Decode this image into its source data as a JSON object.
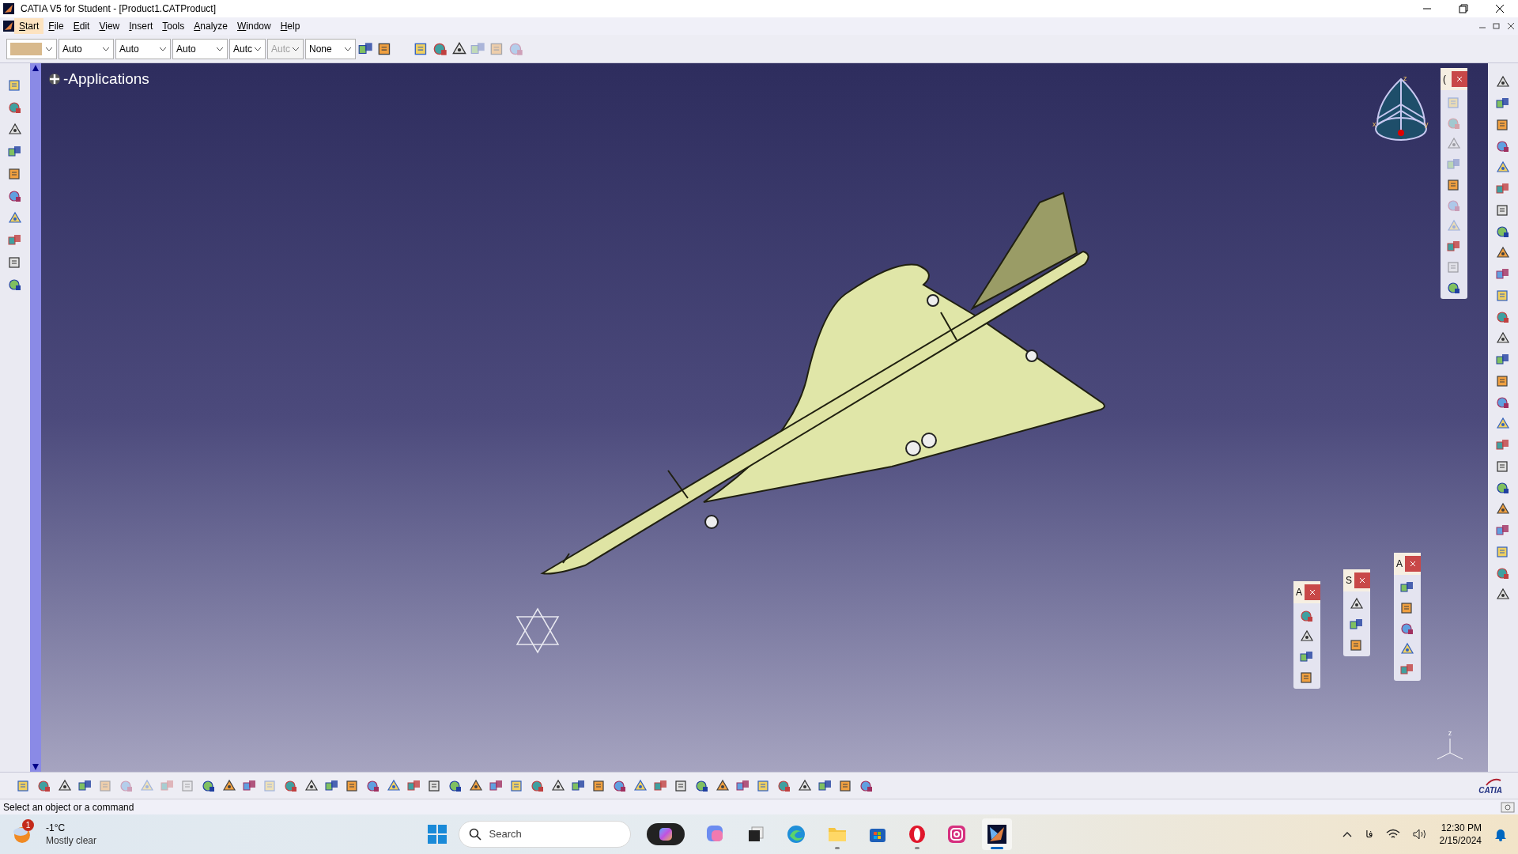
{
  "window": {
    "title": "CATIA V5 for Student - [Product1.CATProduct]"
  },
  "menu": [
    {
      "label": "Start",
      "selected": true
    },
    {
      "label": "File",
      "selected": false
    },
    {
      "label": "Edit",
      "selected": false
    },
    {
      "label": "View",
      "selected": false
    },
    {
      "label": "Insert",
      "selected": false
    },
    {
      "label": "Tools",
      "selected": false
    },
    {
      "label": "Analyze",
      "selected": false
    },
    {
      "label": "Window",
      "selected": false
    },
    {
      "label": "Help",
      "selected": false
    }
  ],
  "combos": [
    {
      "kind": "color",
      "color": "#d8b98c"
    },
    {
      "kind": "text",
      "value": "Auto",
      "disabled": false
    },
    {
      "kind": "text",
      "value": "Auto",
      "disabled": false
    },
    {
      "kind": "text",
      "value": "Auto",
      "disabled": false
    },
    {
      "kind": "text",
      "value": "Autc",
      "disabled": false
    },
    {
      "kind": "text",
      "value": "Autc",
      "disabled": true
    },
    {
      "kind": "text",
      "value": "None",
      "disabled": false
    }
  ],
  "tree": {
    "root": "-Applications"
  },
  "compass": {
    "axes": [
      "z",
      "x",
      "y"
    ]
  },
  "floating_toolbars": [
    {
      "title": "("
    },
    {
      "title": "A"
    },
    {
      "title": "S"
    },
    {
      "title": "A"
    }
  ],
  "axis_triad": {
    "label": "z"
  },
  "logo": {
    "text": "CATIA"
  },
  "status_bar": {
    "text": "Select an object or a command"
  },
  "taskbar": {
    "weather": {
      "badge": "1",
      "temperature": "-1°C",
      "condition": "Mostly clear"
    },
    "search": {
      "placeholder": "Search"
    },
    "apps": [
      {
        "kind": "copilot",
        "running": false,
        "selected": false
      },
      {
        "kind": "preview",
        "running": false,
        "selected": false
      },
      {
        "kind": "taskview",
        "running": false,
        "selected": false
      },
      {
        "kind": "edge",
        "running": false,
        "selected": false
      },
      {
        "kind": "explorer",
        "running": true,
        "selected": false
      },
      {
        "kind": "store",
        "running": false,
        "selected": false
      },
      {
        "kind": "opera",
        "running": true,
        "selected": false
      },
      {
        "kind": "instagram",
        "running": false,
        "selected": false
      },
      {
        "kind": "catia",
        "running": true,
        "selected": true
      }
    ],
    "language": "فا",
    "time": "12:30 PM",
    "date": "2/15/2024"
  }
}
